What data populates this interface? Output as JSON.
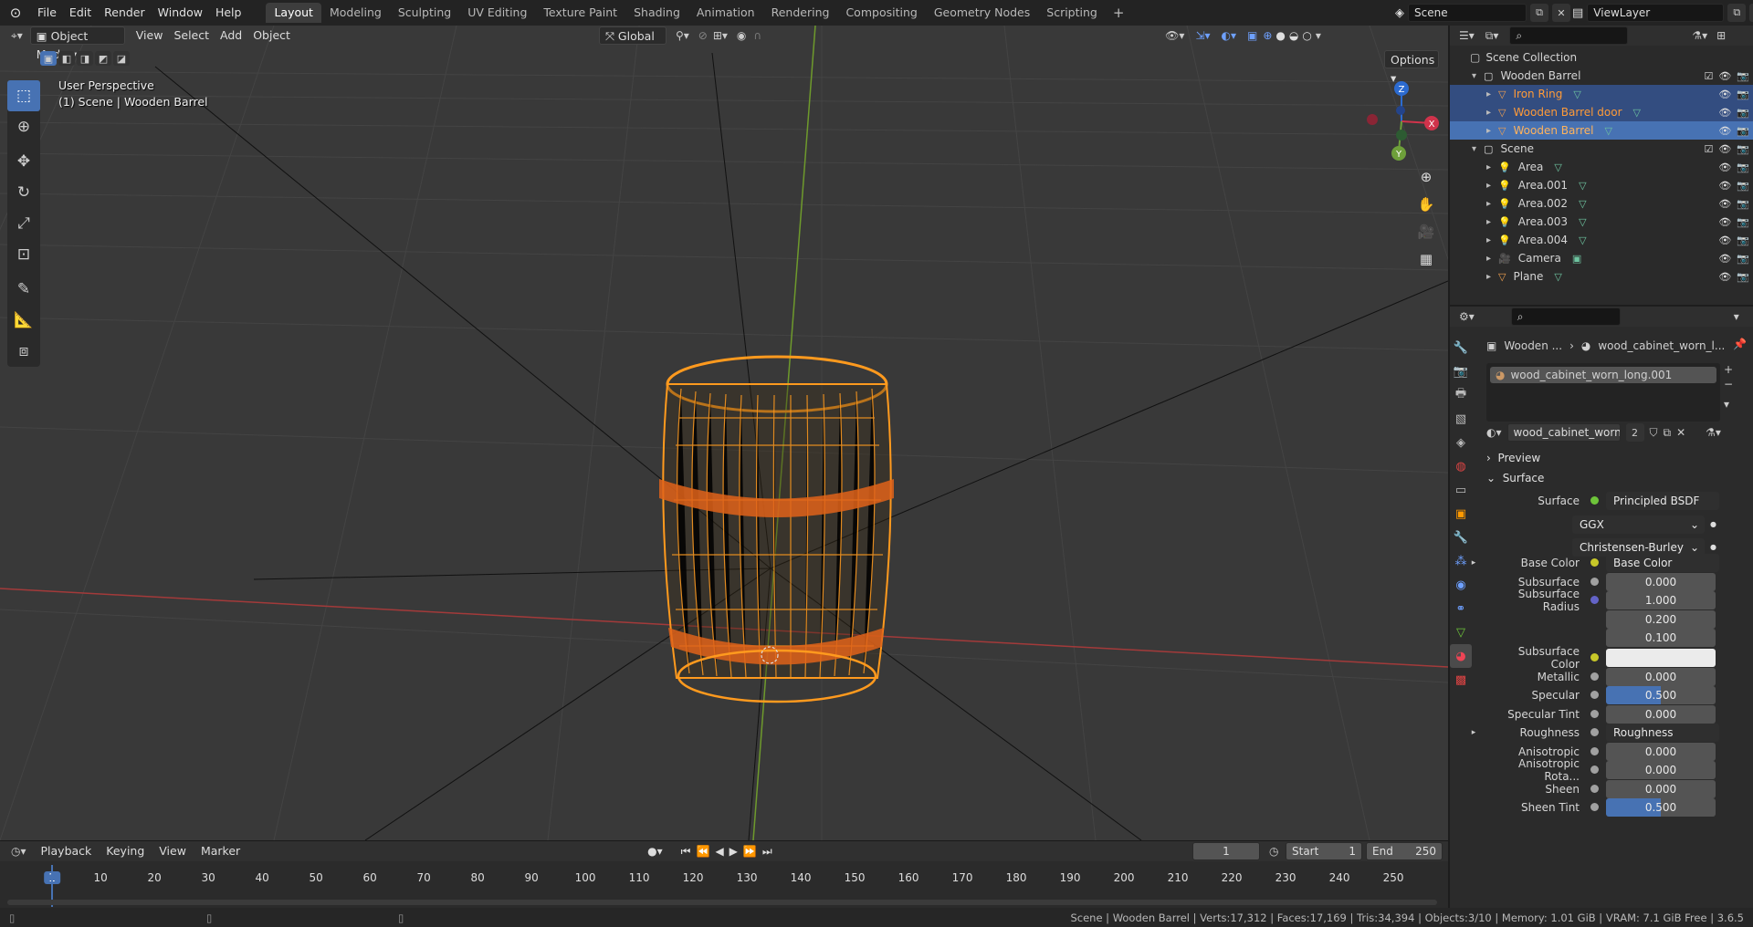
{
  "app": {
    "menus": [
      "File",
      "Edit",
      "Render",
      "Window",
      "Help"
    ],
    "workspaces": [
      "Layout",
      "Modeling",
      "Sculpting",
      "UV Editing",
      "Texture Paint",
      "Shading",
      "Animation",
      "Rendering",
      "Compositing",
      "Geometry Nodes",
      "Scripting"
    ],
    "active_workspace": "Layout",
    "scene": "Scene",
    "view_layer": "ViewLayer"
  },
  "viewport": {
    "mode": "Object Mode",
    "menus": [
      "View",
      "Select",
      "Add",
      "Object"
    ],
    "orientation": "Global",
    "options": "Options",
    "perspective": "User Perspective",
    "context": "(1) Scene | Wooden Barrel",
    "axes": {
      "x": "X",
      "y": "Y",
      "z": "Z"
    },
    "barrel_color": "#ff9a1e"
  },
  "timeline": {
    "menus": [
      "Playback",
      "Keying",
      "View",
      "Marker"
    ],
    "current_frame": "1",
    "start_label": "Start",
    "start": "1",
    "end_label": "End",
    "end": "250",
    "ticks": [
      "1",
      "10",
      "20",
      "30",
      "40",
      "50",
      "60",
      "70",
      "80",
      "90",
      "100",
      "110",
      "120",
      "130",
      "140",
      "150",
      "160",
      "170",
      "180",
      "190",
      "200",
      "210",
      "220",
      "230",
      "240",
      "250"
    ]
  },
  "status": "Scene | Wooden Barrel | Verts:17,312 | Faces:17,169 | Tris:34,394 | Objects:3/10 | Memory: 1.01 GiB | VRAM: 7.1 GiB Free | 3.6.5",
  "outliner": {
    "root": "Scene Collection",
    "rows": [
      {
        "name": "Wooden Barrel",
        "indent": 1,
        "kind": "collection",
        "state": "",
        "orange": false
      },
      {
        "name": "Iron Ring",
        "indent": 2,
        "kind": "mesh",
        "state": "sel",
        "orange": true
      },
      {
        "name": "Wooden Barrel door",
        "indent": 2,
        "kind": "mesh",
        "state": "sel",
        "orange": true
      },
      {
        "name": "Wooden Barrel",
        "indent": 2,
        "kind": "mesh",
        "state": "active",
        "orange": true
      },
      {
        "name": "Scene",
        "indent": 1,
        "kind": "collection",
        "state": "",
        "orange": false
      },
      {
        "name": "Area",
        "indent": 2,
        "kind": "light",
        "state": "",
        "orange": false
      },
      {
        "name": "Area.001",
        "indent": 2,
        "kind": "light",
        "state": "",
        "orange": false
      },
      {
        "name": "Area.002",
        "indent": 2,
        "kind": "light",
        "state": "",
        "orange": false
      },
      {
        "name": "Area.003",
        "indent": 2,
        "kind": "light",
        "state": "",
        "orange": false
      },
      {
        "name": "Area.004",
        "indent": 2,
        "kind": "light",
        "state": "",
        "orange": false
      },
      {
        "name": "Camera",
        "indent": 2,
        "kind": "camera",
        "state": "",
        "orange": false
      },
      {
        "name": "Plane",
        "indent": 2,
        "kind": "mesh",
        "state": "",
        "orange": false
      }
    ]
  },
  "properties": {
    "breadcrumb_object": "Wooden ...",
    "breadcrumb_material": "wood_cabinet_worn_l...",
    "slot": "wood_cabinet_worn_long.001",
    "material_name": "wood_cabinet_worn_l...",
    "users": "2",
    "preview": "Preview",
    "surface_section": "Surface",
    "surface_label": "Surface",
    "surface_value": "Principled BSDF",
    "distribution": "GGX",
    "subsurface_method": "Christensen-Burley",
    "fields": [
      {
        "label": "Base Color",
        "value": "Base Color",
        "dot": "#c7c729",
        "kind": "link",
        "expand": true
      },
      {
        "label": "Subsurface",
        "value": "0.000",
        "dot": "#a1a1a1",
        "kind": "num"
      },
      {
        "label": "Subsurface Radius",
        "value": "1.000",
        "dot": "#6363c7",
        "kind": "num"
      },
      {
        "label": "",
        "value": "0.200",
        "dot": "",
        "kind": "num"
      },
      {
        "label": "",
        "value": "0.100",
        "dot": "",
        "kind": "num"
      },
      {
        "label": "Subsurface Color",
        "value": "",
        "dot": "#c7c729",
        "kind": "white"
      },
      {
        "label": "Metallic",
        "value": "0.000",
        "dot": "#a1a1a1",
        "kind": "num"
      },
      {
        "label": "Specular",
        "value": "0.500",
        "dot": "#a1a1a1",
        "kind": "blue"
      },
      {
        "label": "Specular Tint",
        "value": "0.000",
        "dot": "#a1a1a1",
        "kind": "num"
      },
      {
        "label": "Roughness",
        "value": "Roughness",
        "dot": "#a1a1a1",
        "kind": "link",
        "expand": true
      },
      {
        "label": "Anisotropic",
        "value": "0.000",
        "dot": "#a1a1a1",
        "kind": "num"
      },
      {
        "label": "Anisotropic Rota...",
        "value": "0.000",
        "dot": "#a1a1a1",
        "kind": "num"
      },
      {
        "label": "Sheen",
        "value": "0.000",
        "dot": "#a1a1a1",
        "kind": "num"
      },
      {
        "label": "Sheen Tint",
        "value": "0.500",
        "dot": "#a1a1a1",
        "kind": "blue"
      }
    ]
  }
}
